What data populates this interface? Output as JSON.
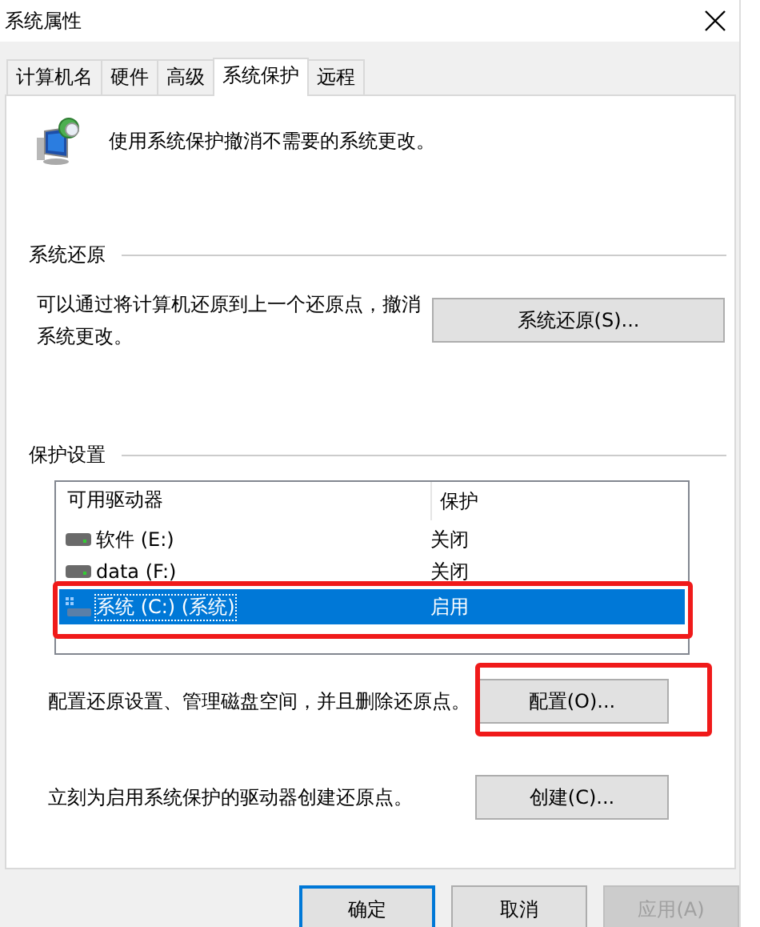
{
  "window": {
    "title": "系统属性"
  },
  "tabs": [
    {
      "label": "计算机名",
      "selected": false
    },
    {
      "label": "硬件",
      "selected": false
    },
    {
      "label": "高级",
      "selected": false
    },
    {
      "label": "系统保护",
      "selected": true
    },
    {
      "label": "远程",
      "selected": false
    }
  ],
  "intro": {
    "text": "使用系统保护撤消不需要的系统更改。"
  },
  "restore": {
    "heading": "系统还原",
    "text": "可以通过将计算机还原到上一个还原点，撤消系统更改。",
    "button": "系统还原(S)..."
  },
  "protection": {
    "heading": "保护设置",
    "columns": [
      "可用驱动器",
      "保护"
    ],
    "drives": [
      {
        "name": "软件 (E:)",
        "protection": "关闭",
        "kind": "disk",
        "selected": false,
        "highlighted": false
      },
      {
        "name": "data (F:)",
        "protection": "关闭",
        "kind": "disk",
        "selected": false,
        "highlighted": false
      },
      {
        "name": "系统 (C:) (系统)",
        "protection": "启用",
        "kind": "system",
        "selected": true,
        "highlighted": true
      }
    ],
    "configure": {
      "text": "配置还原设置、管理磁盘空间，并且删除还原点。",
      "button": "配置(O)...",
      "highlighted": true
    },
    "create": {
      "text": "立刻为启用系统保护的驱动器创建还原点。",
      "button": "创建(C)..."
    }
  },
  "buttons": [
    {
      "label": "确定",
      "kind": "default",
      "disabled": false
    },
    {
      "label": "取消",
      "kind": "normal",
      "disabled": false
    },
    {
      "label": "应用(A)",
      "kind": "normal",
      "disabled": true
    }
  ]
}
